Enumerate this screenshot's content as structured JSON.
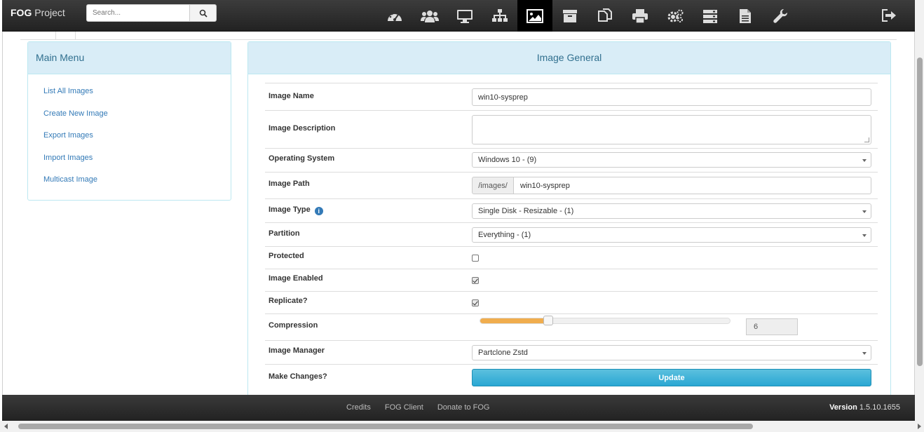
{
  "brand": {
    "strong": "FOG",
    "rest": " Project"
  },
  "search": {
    "placeholder": "Search..."
  },
  "nav_icons": [
    "dashboard-icon",
    "users-icon",
    "monitor-icon",
    "sitemap-icon",
    "image-icon",
    "archive-icon",
    "copy-icon",
    "print-icon",
    "cogs-icon",
    "server-icon",
    "file-icon",
    "wrench-icon"
  ],
  "active_nav": "image-icon",
  "side_menu": {
    "title": "Main Menu",
    "items": [
      "List All Images",
      "Create New Image",
      "Export Images",
      "Import Images",
      "Multicast Image"
    ]
  },
  "main": {
    "title": "Image General",
    "labels": {
      "name": "Image Name",
      "description": "Image Description",
      "os": "Operating System",
      "path": "Image Path",
      "type": "Image Type",
      "partition": "Partition",
      "protected": "Protected",
      "enabled": "Image Enabled",
      "replicate": "Replicate?",
      "compression": "Compression",
      "manager": "Image Manager",
      "changes": "Make Changes?"
    },
    "values": {
      "name": "win10-sysprep",
      "description": "",
      "os": "Windows 10 - (9)",
      "path_prefix": "/images/",
      "path": "win10-sysprep",
      "type": "Single Disk - Resizable - (1)",
      "partition": "Everything - (1)",
      "protected": false,
      "enabled": true,
      "replicate": true,
      "compression": "6",
      "compression_max": 22,
      "manager": "Partclone Zstd"
    },
    "update_label": "Update"
  },
  "footer": {
    "links": [
      "Credits",
      "FOG Client",
      "Donate to FOG"
    ],
    "version_label": "Version",
    "version": "1.5.10.1655"
  }
}
